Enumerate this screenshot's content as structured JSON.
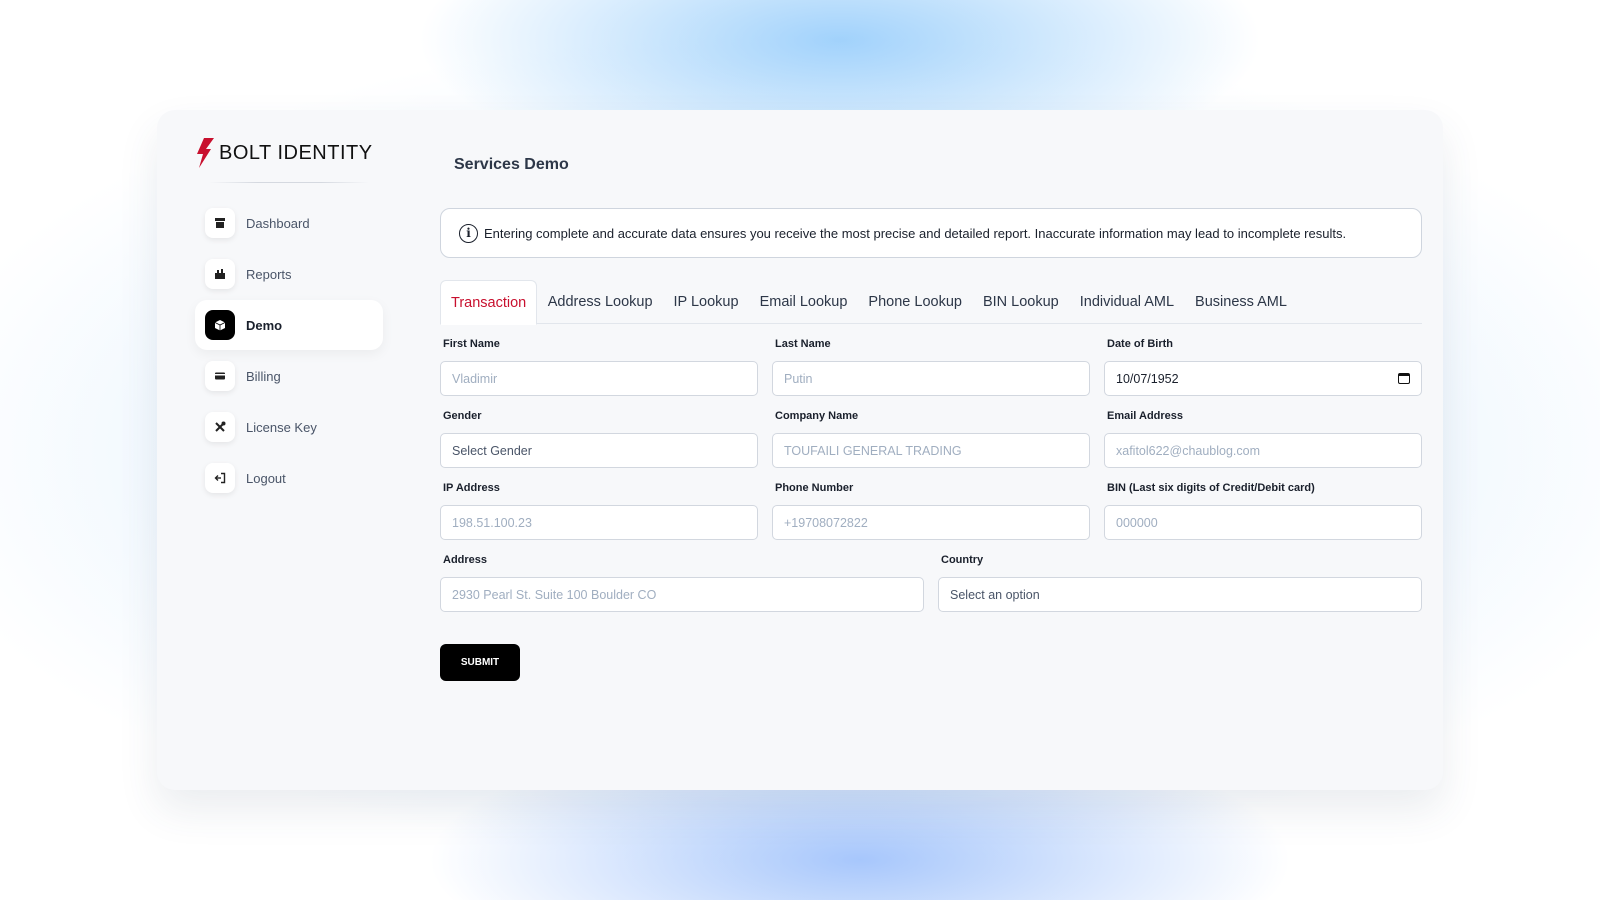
{
  "brand": {
    "name": "BOLT IDENTITY",
    "accent": "#c8102e"
  },
  "sidebar": {
    "items": [
      {
        "label": "Dashboard",
        "icon": "store-icon",
        "active": false
      },
      {
        "label": "Reports",
        "icon": "chart-icon",
        "active": false
      },
      {
        "label": "Demo",
        "icon": "cube-icon",
        "active": true
      },
      {
        "label": "Billing",
        "icon": "credit-card-icon",
        "active": false
      },
      {
        "label": "License Key",
        "icon": "tools-icon",
        "active": false
      },
      {
        "label": "Logout",
        "icon": "logout-icon",
        "active": false
      }
    ]
  },
  "page": {
    "title": "Services Demo"
  },
  "notice": {
    "text": "Entering complete and accurate data ensures you receive the most precise and detailed report. Inaccurate information may lead to incomplete results."
  },
  "tabs": [
    {
      "label": "Transaction",
      "active": true
    },
    {
      "label": "Address Lookup",
      "active": false
    },
    {
      "label": "IP Lookup",
      "active": false
    },
    {
      "label": "Email Lookup",
      "active": false
    },
    {
      "label": "Phone Lookup",
      "active": false
    },
    {
      "label": "BIN Lookup",
      "active": false
    },
    {
      "label": "Individual AML",
      "active": false
    },
    {
      "label": "Business AML",
      "active": false
    }
  ],
  "form": {
    "first_name": {
      "label": "First Name",
      "placeholder": "Vladimir",
      "value": ""
    },
    "last_name": {
      "label": "Last Name",
      "placeholder": "Putin",
      "value": ""
    },
    "dob": {
      "label": "Date of Birth",
      "value": "10/07/1952"
    },
    "gender": {
      "label": "Gender",
      "value": "Select Gender"
    },
    "company": {
      "label": "Company Name",
      "placeholder": "TOUFAILI GENERAL TRADING",
      "value": ""
    },
    "email": {
      "label": "Email Address",
      "placeholder": "xafitol622@chaublog.com",
      "value": ""
    },
    "ip": {
      "label": "IP Address",
      "placeholder": "198.51.100.23",
      "value": ""
    },
    "phone": {
      "label": "Phone Number",
      "placeholder": "+19708072822",
      "value": ""
    },
    "bin": {
      "label": "BIN (Last six digits of Credit/Debit card)",
      "placeholder": "000000",
      "value": ""
    },
    "address": {
      "label": "Address",
      "placeholder": "2930 Pearl St. Suite 100 Boulder CO",
      "value": ""
    },
    "country": {
      "label": "Country",
      "value": "Select an option"
    },
    "submit_label": "SUBMIT"
  }
}
